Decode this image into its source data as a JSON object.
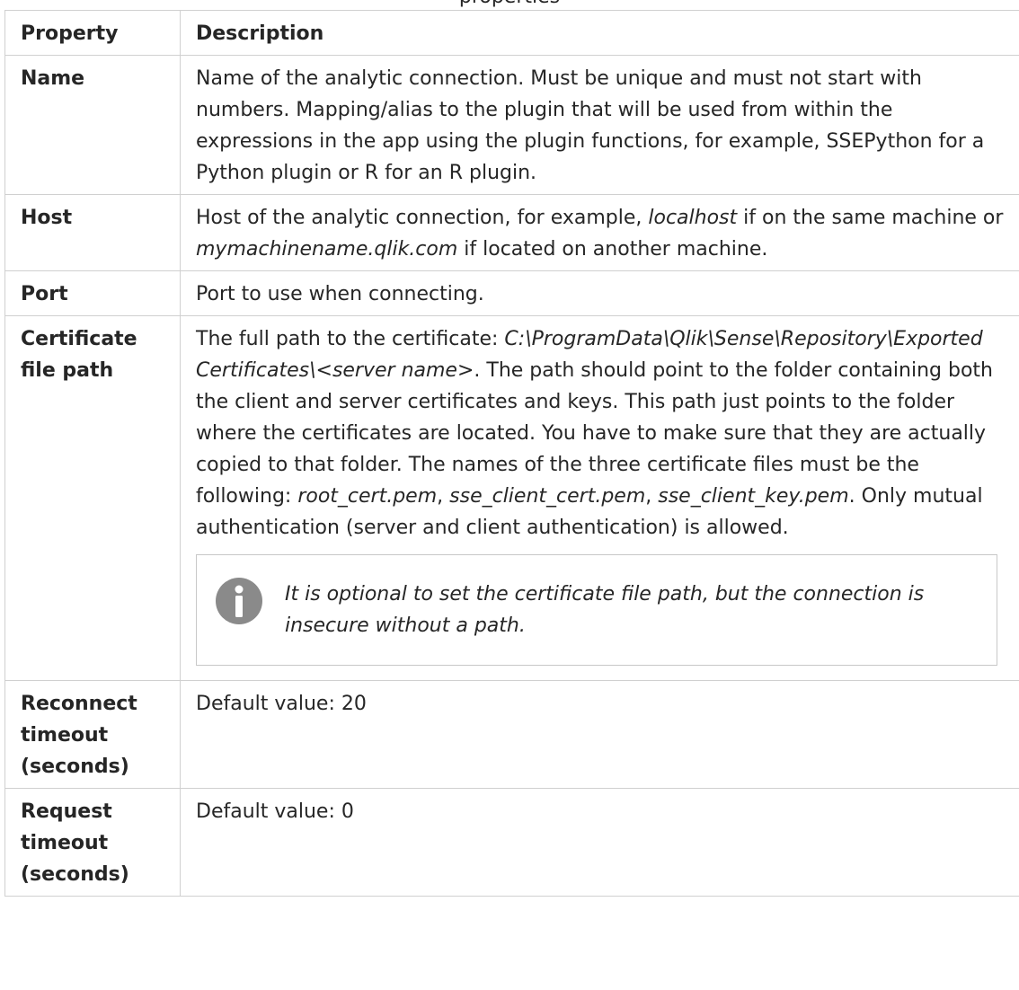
{
  "caption_fragment": "properties",
  "table": {
    "headers": {
      "property": "Property",
      "description": "Description"
    },
    "rows": {
      "name": {
        "property": "Name",
        "description": "Name of the analytic connection. Must be unique and must not start with numbers. Mapping/alias to the plugin that will be used from within the expressions in the app using the plugin functions, for example, SSEPython for a Python plugin or R for an R plugin."
      },
      "host": {
        "property": "Host",
        "d1": "Host of the analytic connection, for example, ",
        "d2": "localhost",
        "d3": " if on the same machine or ",
        "d4": "mymachinename.qlik.com",
        "d5": " if located on another machine."
      },
      "port": {
        "property": "Port",
        "description": "Port to use when connecting."
      },
      "cert": {
        "property": "Certificate file path",
        "d1": "The full path to the certificate: ",
        "d2": "C:\\ProgramData\\Qlik\\Sense\\Repository\\Exported Certificates\\<server name>",
        "d3": ". The path should point to the folder containing both the client and server certificates and keys. This path just points to the folder where the certificates are located. You have to make sure that they are actually copied to that folder. The names of the three certificate files must be the following: ",
        "d4": "root_cert.pem",
        "d5": ", ",
        "d6": "sse_client_cert.pem",
        "d7": ", ",
        "d8": "sse_client_key.pem",
        "d9": ". Only mutual authentication (server and client authentication) is allowed.",
        "note": "It is optional to set the certificate file path, but the connection is insecure without a path.",
        "note_icon": "info-icon"
      },
      "reconnect": {
        "property": "Reconnect timeout (seconds)",
        "description": "Default value: 20"
      },
      "request": {
        "property": "Request timeout (seconds)",
        "description": "Default value: 0"
      }
    }
  },
  "colors": {
    "border": "#d0d0d0",
    "text": "#262626",
    "note_icon": "#8a8a8a"
  }
}
